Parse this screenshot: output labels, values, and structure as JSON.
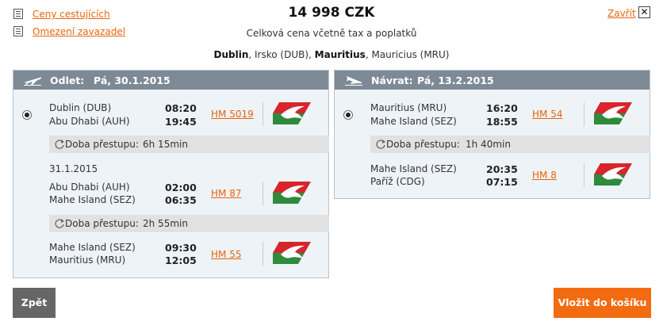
{
  "header": {
    "links": {
      "fares": "Ceny cestujících",
      "baggage": "Omezení zavazadel"
    },
    "close_label": "Zavřít",
    "close_glyph": "✕",
    "price": "14 998  CZK",
    "price_sub": "Celková cena včetně tax a poplatků",
    "route": {
      "from_city": "Dublin",
      "from_rest": ", Irsko (DUB), ",
      "to_city": "Mauritius",
      "to_rest": ", Mauricius (MRU)"
    }
  },
  "outbound": {
    "label": "Odlet:",
    "date": "Pá, 30.1.2015",
    "segments": [
      {
        "from": "Dublin (DUB)",
        "to": "Abu Dhabi (AUH)",
        "dep": "08:20",
        "arr": "19:45",
        "flight": "HM 5019"
      },
      {
        "date": "31.1.2015",
        "from": "Abu Dhabi (AUH)",
        "to": "Mahe Island (SEZ)",
        "dep": "02:00",
        "arr": "06:35",
        "flight": "HM 87"
      },
      {
        "from": "Mahe Island (SEZ)",
        "to": "Mauritius (MRU)",
        "dep": "09:30",
        "arr": "12:05",
        "flight": "HM 55"
      }
    ],
    "transfers": [
      {
        "label": "Doba přestupu:",
        "value": "6h 15min"
      },
      {
        "label": "Doba přestupu:",
        "value": "2h 55min"
      }
    ]
  },
  "return": {
    "label": "Návrat:",
    "date": "Pá, 13.2.2015",
    "segments": [
      {
        "from": "Mauritius (MRU)",
        "to": "Mahe Island (SEZ)",
        "dep": "16:20",
        "arr": "18:55",
        "flight": "HM 54"
      },
      {
        "from": "Mahe Island (SEZ)",
        "to": "Paříž (CDG)",
        "dep": "20:35",
        "arr": "07:15",
        "flight": "HM 8"
      }
    ],
    "transfers": [
      {
        "label": "Doba přestupu:",
        "value": "1h 40min"
      }
    ]
  },
  "buttons": {
    "back": "Zpět",
    "add_to_cart": "Vložit do košíku"
  },
  "colors": {
    "accent": "#f36b10",
    "link": "#e8650b",
    "panel_header": "#7d8a96",
    "logo_red": "#d8242b",
    "logo_green": "#2e8b3c"
  }
}
